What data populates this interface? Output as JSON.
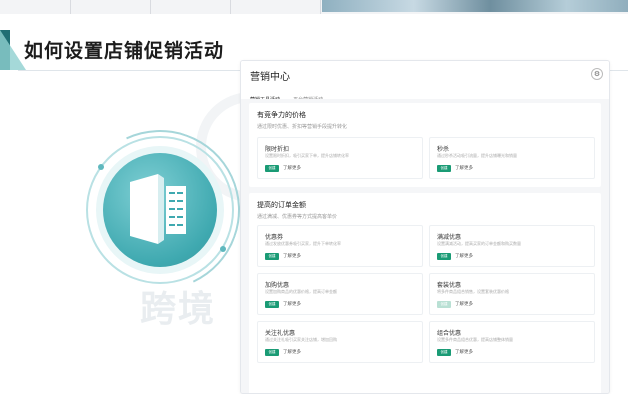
{
  "slide": {
    "title": "如何设置店铺促销活动",
    "watermark": "跨境"
  },
  "panel": {
    "title": "营销中心",
    "tabs": [
      {
        "label": "营销工具活动"
      },
      {
        "label": "平台营销活动"
      }
    ],
    "sections": [
      {
        "title": "有竞争力的价格",
        "subtitle": "通过限时优惠、折扣等营销手段提升转化",
        "cards": [
          {
            "title": "限时折扣",
            "desc": "设置限时折扣，吸引买家下单，提升店铺转化率",
            "badge": "创建",
            "link": "了解更多"
          },
          {
            "title": "秒杀",
            "desc": "通过秒杀活动吸引流量，提升店铺曝光和销量",
            "badge": "创建",
            "link": "了解更多"
          }
        ]
      },
      {
        "title": "提高的订单金额",
        "subtitle": "通过满减、优惠券等方式提高客单价",
        "cards": [
          {
            "title": "优惠券",
            "desc": "通过发放优惠券吸引买家，提升下单转化率",
            "badge": "创建",
            "link": "了解更多"
          },
          {
            "title": "满减优惠",
            "desc": "设置满减活动，提高买家的订单金额和购买数量",
            "badge": "创建",
            "link": "了解更多"
          },
          {
            "title": "加购优惠",
            "desc": "设置加购商品的优惠价格，提高订单金额",
            "badge": "创建",
            "link": "了解更多"
          },
          {
            "title": "套装优惠",
            "desc": "将多件商品组合销售，设置套装优惠价格",
            "badge": "创建",
            "link": "了解更多"
          },
          {
            "title": "关注礼优惠",
            "desc": "通过关注礼吸引买家关注店铺，增加回购",
            "badge": "创建",
            "link": "了解更多"
          },
          {
            "title": "组合优惠",
            "desc": "设置多件商品组合优惠，提高店铺整体销量",
            "badge": "创建",
            "link": "了解更多"
          }
        ]
      }
    ]
  },
  "colors": {
    "accent": "#1a9b75",
    "teal": "#3fa9b0",
    "title_accent": "#1f6e74"
  }
}
